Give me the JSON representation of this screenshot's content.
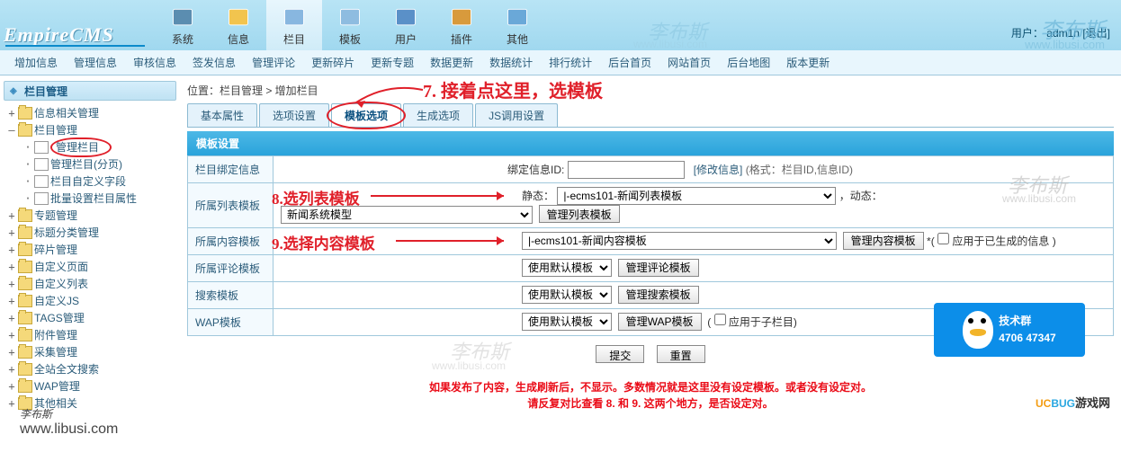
{
  "logo": "EmpireCMS",
  "user": {
    "label": "用户：",
    "name": "adm1n",
    "logout": "[退出]"
  },
  "watermark": {
    "name": "李布斯",
    "url": "www.libusi.com"
  },
  "nav": [
    {
      "label": "系统"
    },
    {
      "label": "信息"
    },
    {
      "label": "栏目"
    },
    {
      "label": "模板"
    },
    {
      "label": "用户"
    },
    {
      "label": "插件"
    },
    {
      "label": "其他"
    }
  ],
  "menu": [
    "增加信息",
    "管理信息",
    "审核信息",
    "签发信息",
    "管理评论",
    "更新碎片",
    "更新专题",
    "数据更新",
    "数据统计",
    "排行统计",
    "后台首页",
    "网站首页",
    "后台地图",
    "版本更新"
  ],
  "sidebar": {
    "title": "栏目管理",
    "items": [
      {
        "lvl": 1,
        "ic": "+",
        "t": "folder",
        "label": "信息相关管理"
      },
      {
        "lvl": 1,
        "ic": "–",
        "t": "folder",
        "label": "栏目管理"
      },
      {
        "lvl": 2,
        "ic": "",
        "t": "file",
        "label": "管理栏目",
        "circle": true
      },
      {
        "lvl": 2,
        "ic": "",
        "t": "file",
        "label": "管理栏目(分页)"
      },
      {
        "lvl": 2,
        "ic": "",
        "t": "file",
        "label": "栏目自定义字段"
      },
      {
        "lvl": 2,
        "ic": "",
        "t": "file",
        "label": "批量设置栏目属性"
      },
      {
        "lvl": 1,
        "ic": "+",
        "t": "folder",
        "label": "专题管理"
      },
      {
        "lvl": 1,
        "ic": "+",
        "t": "folder",
        "label": "标题分类管理"
      },
      {
        "lvl": 1,
        "ic": "+",
        "t": "folder",
        "label": "碎片管理"
      },
      {
        "lvl": 1,
        "ic": "+",
        "t": "folder",
        "label": "自定义页面"
      },
      {
        "lvl": 1,
        "ic": "+",
        "t": "folder",
        "label": "自定义列表"
      },
      {
        "lvl": 1,
        "ic": "+",
        "t": "folder",
        "label": "自定义JS"
      },
      {
        "lvl": 1,
        "ic": "+",
        "t": "folder",
        "label": "TAGS管理"
      },
      {
        "lvl": 1,
        "ic": "+",
        "t": "folder",
        "label": "附件管理"
      },
      {
        "lvl": 1,
        "ic": "+",
        "t": "folder",
        "label": "采集管理"
      },
      {
        "lvl": 1,
        "ic": "+",
        "t": "folder",
        "label": "全站全文搜索"
      },
      {
        "lvl": 1,
        "ic": "+",
        "t": "folder",
        "label": "WAP管理"
      },
      {
        "lvl": 1,
        "ic": "+",
        "t": "folder",
        "label": "其他相关"
      }
    ]
  },
  "breadcrumb": "位置：栏目管理 > 增加栏目",
  "tabs": [
    "基本属性",
    "选项设置",
    "模板选项",
    "生成选项",
    "JS调用设置"
  ],
  "active_tab": 2,
  "annotations": {
    "a7": "7. 接着点这里，选模板",
    "a8": "8.选列表模板",
    "a9": "9.选择内容模板",
    "bottom1": "如果发布了内容，生成刷新后，不显示。多数情况就是这里没有设定模板。或者没有设定对。",
    "bottom2": "请反复对比查看 8. 和 9. 这两个地方，是否设定对。"
  },
  "panel_title": "模板设置",
  "rows": {
    "bindinfo": {
      "label": "栏目绑定信息",
      "sublabel": "绑定信息ID:",
      "value": "",
      "edit": "[修改信息]",
      "hint": "(格式：栏目ID,信息ID)"
    },
    "listtpl": {
      "label": "所属列表模板",
      "static": "静态：",
      "static_val": "|-ecms101-新闻列表模板",
      "dyn": "，动态：",
      "dyn_val": "新闻系统模型",
      "btn": "管理列表模板"
    },
    "conttpl": {
      "label": "所属内容模板",
      "val": "|-ecms101-新闻内容模板",
      "btn": "管理内容模板",
      "star": "*(",
      "chk": "应用于已生成的信息  )"
    },
    "comtpl": {
      "label": "所属评论模板",
      "val": "使用默认模板",
      "btn": "管理评论模板"
    },
    "schtpl": {
      "label": "搜索模板",
      "val": "使用默认模板",
      "btn": "管理搜索模板"
    },
    "waptpl": {
      "label": "WAP模板",
      "val": "使用默认模板",
      "btn": "管理WAP模板",
      "chk": "应用于子栏目)"
    }
  },
  "btns": {
    "submit": "提交",
    "reset": "重置"
  },
  "qq": {
    "label": "技术群",
    "num": "4706 47347"
  },
  "ucbug": {
    "a": "UC",
    "b": "BUG",
    "c": "游戏网"
  }
}
